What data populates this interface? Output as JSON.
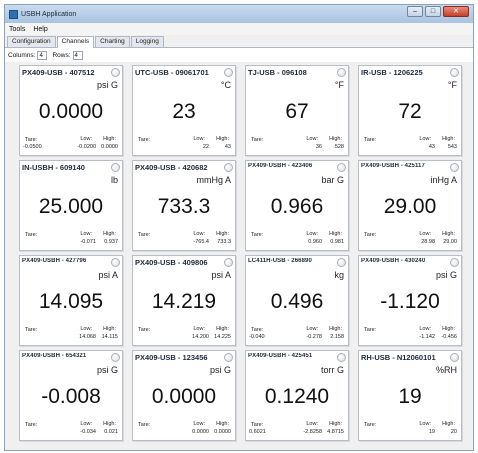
{
  "window": {
    "title": "USBH Application",
    "minimize_label": "–",
    "maximize_label": "□",
    "close_label": "✕"
  },
  "menu": {
    "items": [
      {
        "label": "Tools"
      },
      {
        "label": "Help"
      }
    ]
  },
  "tabs": [
    {
      "label": "Configuration"
    },
    {
      "label": "Channels"
    },
    {
      "label": "Charting"
    },
    {
      "label": "Logging"
    }
  ],
  "config": {
    "columns_label": "Columns:",
    "columns_value": "4",
    "rows_label": "Rows:",
    "rows_value": "4"
  },
  "labels": {
    "tare": "Tare:",
    "low": "Low:",
    "high": "High:"
  },
  "cards": [
    {
      "title": "PX409-USB - 407512",
      "unit": "psi G",
      "value": "0.0000",
      "tare": "-0.0500",
      "low": "-0.0200",
      "high": "0.0000"
    },
    {
      "title": "UTC-USB - 09061701",
      "unit": "°C",
      "value": "23",
      "tare": "",
      "low": "22",
      "high": "43"
    },
    {
      "title": "TJ-USB - 096108",
      "unit": "°F",
      "value": "67",
      "tare": "",
      "low": "36",
      "high": "528"
    },
    {
      "title": "IR-USB - 1206225",
      "unit": "°F",
      "value": "72",
      "tare": "",
      "low": "43",
      "high": "543"
    },
    {
      "title": "IN-USBH - 609140",
      "unit": "lb",
      "value": "25.000",
      "tare": "",
      "low": "-0.071",
      "high": "0.937"
    },
    {
      "title": "PX409-USB - 420682",
      "unit": "mmHg A",
      "value": "733.3",
      "tare": "",
      "low": "-765.4",
      "high": "733.3"
    },
    {
      "title": "PX409-USBH - 423406",
      "unit": "bar G",
      "value": "0.966",
      "tare": "",
      "low": "0.960",
      "high": "0.981"
    },
    {
      "title": "PX409-USBH - 425117",
      "unit": "inHg A",
      "value": "29.00",
      "tare": "",
      "low": "28.98",
      "high": "29.00"
    },
    {
      "title": "PX409-USBH - 427796",
      "unit": "psi A",
      "value": "14.095",
      "tare": "",
      "low": "14.068",
      "high": "14.115"
    },
    {
      "title": "PX409-USB - 409806",
      "unit": "psi A",
      "value": "14.219",
      "tare": "",
      "low": "14.200",
      "high": "14.225"
    },
    {
      "title": "LC411H-USB - 266890",
      "unit": "kg",
      "value": "0.496",
      "tare": "-0.040",
      "low": "-0.278",
      "high": "2.158"
    },
    {
      "title": "PX409-USBH - 430240",
      "unit": "psi G",
      "value": "-1.120",
      "tare": "",
      "low": "-1.142",
      "high": "-0.456"
    },
    {
      "title": "PX409-USBH - 654321",
      "unit": "psi G",
      "value": "-0.008",
      "tare": "",
      "low": "-0.034",
      "high": "0.021"
    },
    {
      "title": "PX409-USB - 123456",
      "unit": "psi G",
      "value": "0.0000",
      "tare": "",
      "low": "0.0000",
      "high": "0.0000"
    },
    {
      "title": "PX409-USBH - 425451",
      "unit": "torr G",
      "value": "0.1240",
      "tare": "0.6021",
      "low": "-2.8258",
      "high": "4.8715"
    },
    {
      "title": "RH-USB - N12060101",
      "unit": "%RH",
      "value": "19",
      "tare": "",
      "low": "19",
      "high": "20"
    }
  ]
}
